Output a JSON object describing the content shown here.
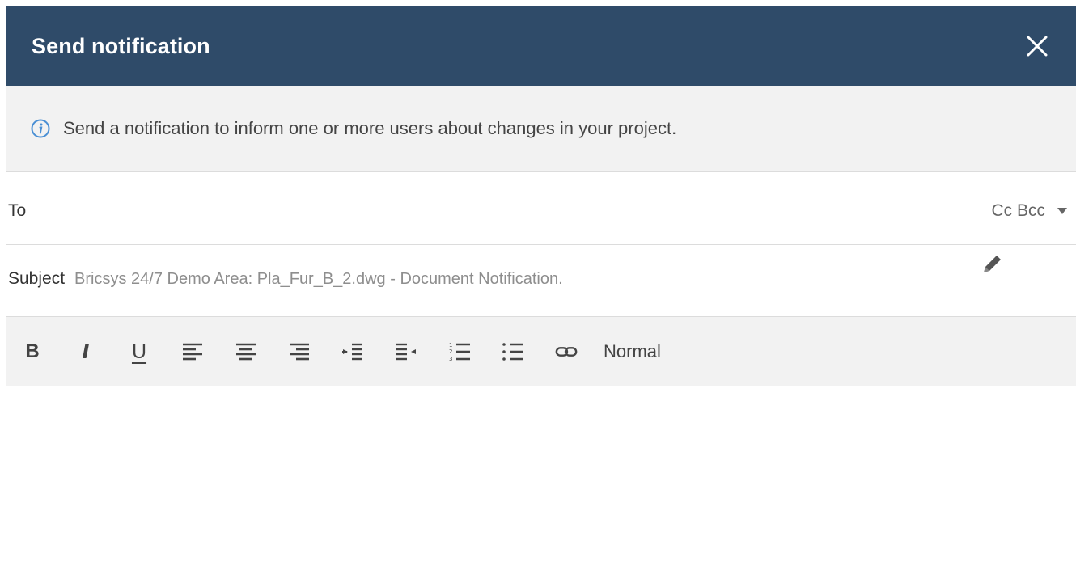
{
  "dialog": {
    "title": "Send notification",
    "close_icon": "close-icon"
  },
  "info": {
    "icon": "info-icon",
    "message": "Send a notification to inform one or more users about changes in your project."
  },
  "recipients": {
    "to_label": "To",
    "to_value": "",
    "ccbcc_label": "Cc Bcc"
  },
  "subject": {
    "label": "Subject",
    "value": "Bricsys 24/7 Demo Area: Pla_Fur_B_2.dwg - Document Notification.",
    "edit_icon": "pencil-icon"
  },
  "toolbar": {
    "bold": "B",
    "italic": "I",
    "underline": "U",
    "tools": [
      "align-left",
      "align-center",
      "align-right",
      "indent",
      "outdent",
      "ordered-list",
      "bullet-list",
      "link"
    ],
    "format_value": "Normal"
  },
  "colors": {
    "header_bg": "#2f4b69",
    "info_icon": "#4a8fd4",
    "panel_bg": "#f2f2f2"
  }
}
